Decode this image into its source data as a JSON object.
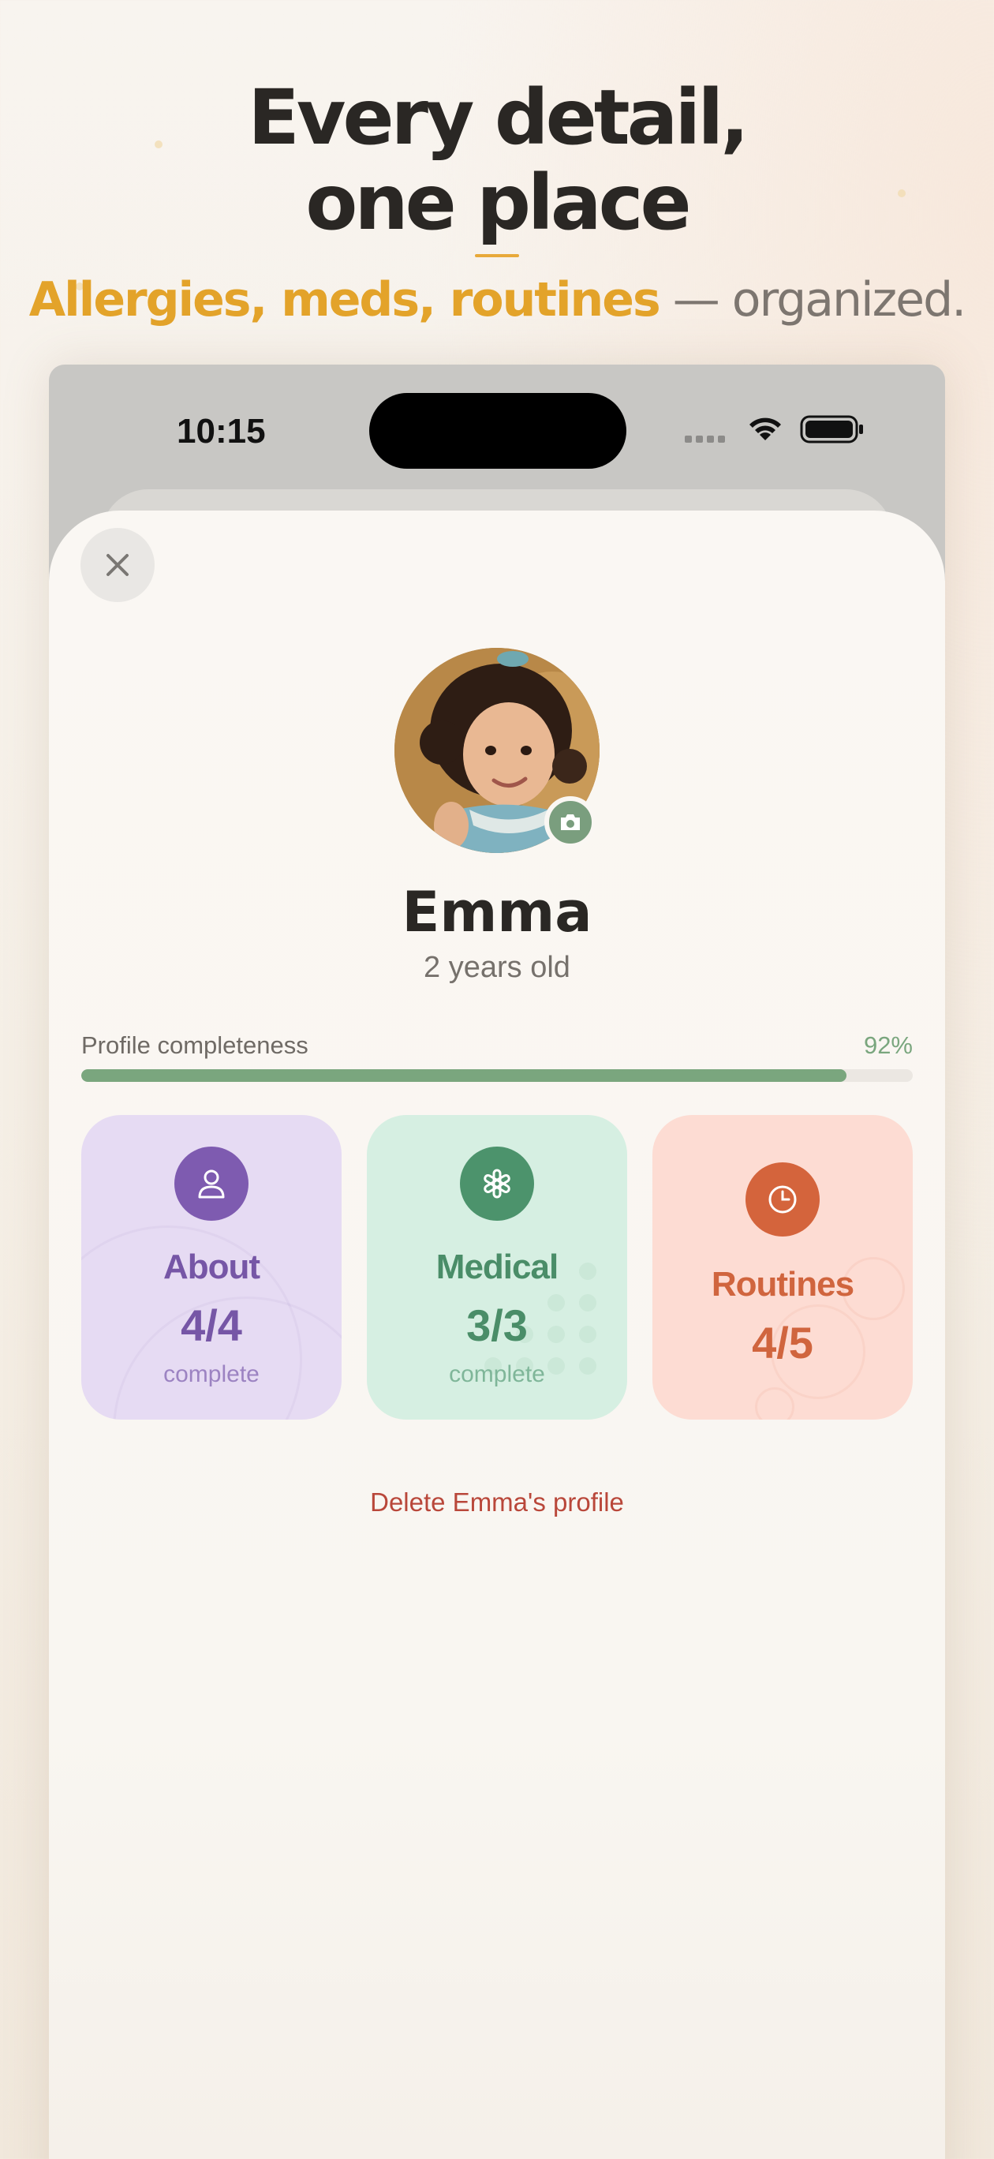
{
  "headline": {
    "line1": "Every detail,",
    "line2": "one place"
  },
  "subline": {
    "accent": "Allergies, meds, routines",
    "rest": " — organized."
  },
  "status_bar": {
    "time": "10:15"
  },
  "profile": {
    "name": "Emma",
    "age": "2 years old",
    "completeness_label": "Profile completeness",
    "completeness_pct_text": "92%",
    "completeness_value": 0.92
  },
  "cards": [
    {
      "title": "About",
      "count": "4/4",
      "sub": "complete",
      "icon": "person-icon",
      "color": "#7e5bb0"
    },
    {
      "title": "Medical",
      "count": "3/3",
      "sub": "complete",
      "icon": "medical-asterisk-icon",
      "color": "#4c936c"
    },
    {
      "title": "Routines",
      "count": "4/5",
      "icon": "clock-icon",
      "color": "#d4643c"
    }
  ],
  "delete_label": "Delete Emma's profile",
  "colors": {
    "accent": "#e3a32a",
    "progress": "#7aa67e",
    "delete": "#b9473a"
  }
}
